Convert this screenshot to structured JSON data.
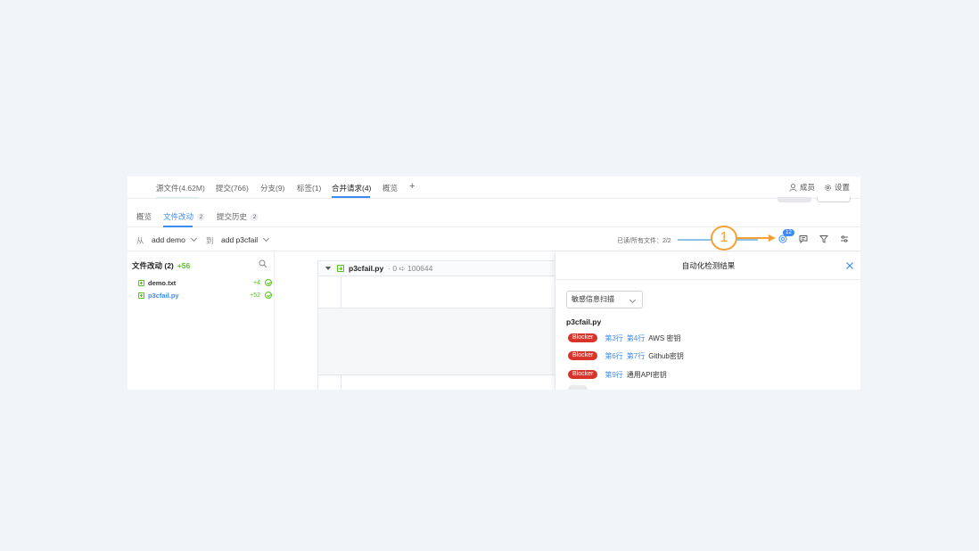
{
  "topnav": {
    "tabs": [
      {
        "label": "源文件(4.62M)"
      },
      {
        "label": "提交(766)"
      },
      {
        "label": "分支(9)"
      },
      {
        "label": "标签(1)"
      },
      {
        "label": "合并请求(4)"
      },
      {
        "label": "概览"
      }
    ],
    "add_symbol": "+",
    "members_label": "成员",
    "settings_label": "设置"
  },
  "subtabs": {
    "overview": "概览",
    "file_changes": "文件改动",
    "file_changes_count": "2",
    "commit_history": "提交历史",
    "commit_history_count": "2"
  },
  "branchbar": {
    "from_label": "从",
    "from_branch": "add demo",
    "to_label": "到",
    "to_branch": "add p3cfail",
    "read_files": "已读/所有文件：2/2",
    "detection_count": "12"
  },
  "filepane": {
    "title": "文件改动 (2)",
    "total_added": "+56",
    "files": [
      {
        "name": "demo.txt",
        "added": "+4"
      },
      {
        "name": "p3cfail.py",
        "added": "+52"
      }
    ]
  },
  "diff": {
    "filename": "p3cfail.py",
    "meta": "· 0 ➪ 100644"
  },
  "panel": {
    "title": "自动化检测结果",
    "scan_type": "敏感信息扫描",
    "file": "p3cfail.py",
    "issues": [
      {
        "severity": "Blocker",
        "line_a": "第3行",
        "line_b": "第4行",
        "desc": "AWS 密钥"
      },
      {
        "severity": "Blocker",
        "line_a": "第6行",
        "line_b": "第7行",
        "desc": "Github密钥"
      },
      {
        "severity": "Blocker",
        "line_a": "第9行",
        "line_b": "",
        "desc": "通用API密钥"
      }
    ]
  },
  "annotation": {
    "number": "1",
    "color": "#f5a035"
  },
  "colors": {
    "accent": "#3d8bf2",
    "added": "#52c41a",
    "blocker": "#d9342b"
  }
}
